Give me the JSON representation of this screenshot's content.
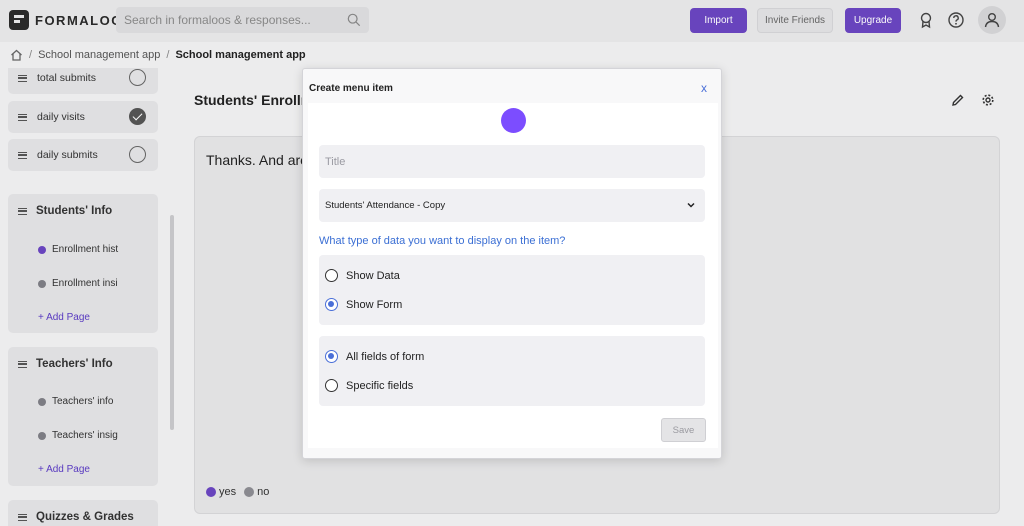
{
  "header": {
    "logo_text": "FORMALOO",
    "search_placeholder": "Search in formaloos & responses...",
    "import_label": "Import",
    "invite_label": "Invite Friends",
    "upgrade_label": "Upgrade"
  },
  "breadcrumb": {
    "items": [
      "School management app",
      "School management app"
    ]
  },
  "sidebar": {
    "widgets": [
      {
        "label": "total submits",
        "checked": false
      },
      {
        "label": "daily visits",
        "checked": true
      },
      {
        "label": "daily submits",
        "checked": false
      }
    ],
    "groups": [
      {
        "title": "Students' Info",
        "pages": [
          "Enrollment hist",
          "Enrollment insi"
        ],
        "add_label": "+ Add Page"
      },
      {
        "title": "Teachers' Info",
        "pages": [
          "Teachers' info",
          "Teachers' insig"
        ],
        "add_label": "+ Add Page"
      },
      {
        "title": "Quizzes & Grades"
      }
    ]
  },
  "main": {
    "title": "Students' Enrollm",
    "text": "Thanks. And are",
    "legend": [
      {
        "label": "yes",
        "color": "#6b46c1"
      },
      {
        "label": "no",
        "color": "#8c8c92"
      }
    ]
  },
  "modal": {
    "title": "Create menu item",
    "close_label": "x",
    "title_placeholder": "Title",
    "selected_form": "Students' Attendance - Copy",
    "question": "What type of data you want to display on the item?",
    "display_options": [
      "Show Data",
      "Show Form"
    ],
    "display_selected": 1,
    "field_options": [
      "All fields of form",
      "Specific fields"
    ],
    "field_selected": 0,
    "save_label": "Save",
    "accent_color": "#7c4dff"
  }
}
